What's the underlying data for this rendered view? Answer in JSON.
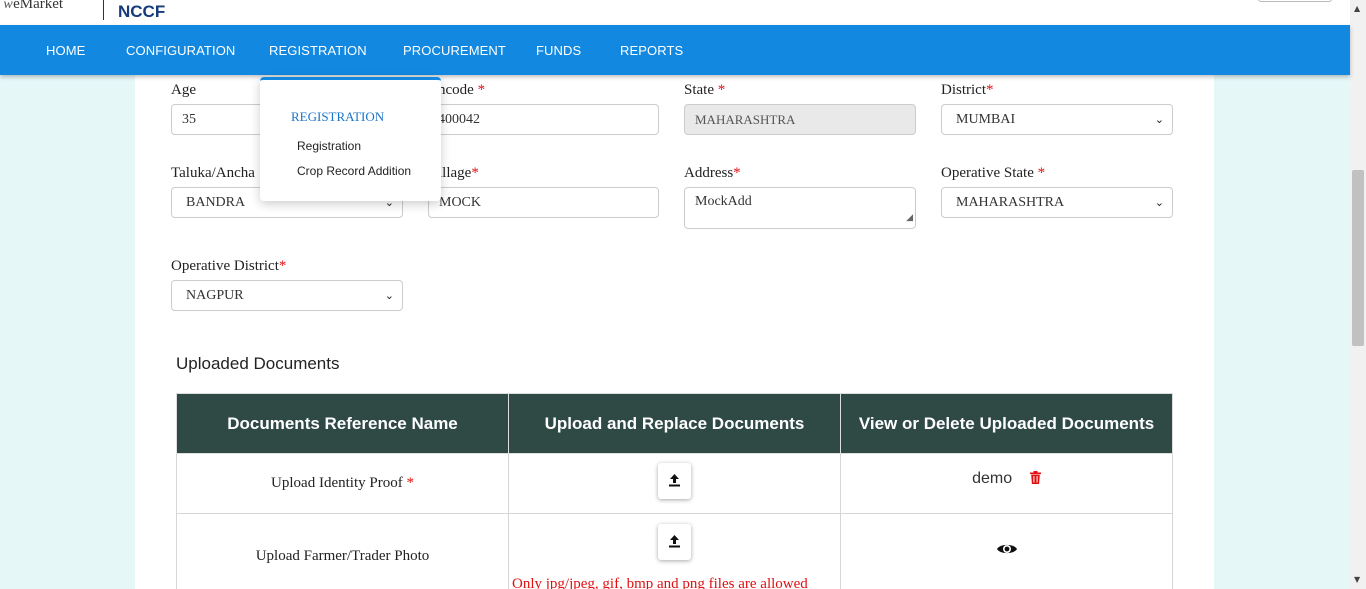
{
  "brand": {
    "emarket": "eMarket",
    "nccf": "NCCF"
  },
  "nav": [
    "HOME",
    "CONFIGURATION",
    "REGISTRATION",
    "PROCUREMENT",
    "FUNDS",
    "REPORTS"
  ],
  "dropdown": {
    "heading": "REGISTRATION",
    "items": [
      "Registration",
      "Crop Record Addition"
    ]
  },
  "form": {
    "age": {
      "label": "Age",
      "value": "35"
    },
    "pincode": {
      "label": "ncode",
      "required": "*",
      "value": "400042"
    },
    "state": {
      "label": "State",
      "required": "*",
      "value": "MAHARASHTRA"
    },
    "district": {
      "label": "District",
      "required": "*",
      "value": "MUMBAI"
    },
    "taluka": {
      "label": "Taluka/Ancha",
      "value": "BANDRA"
    },
    "village": {
      "label": "illage",
      "required": "*",
      "value": "MOCK"
    },
    "address": {
      "label": "Address",
      "required": "*",
      "value": "MockAdd"
    },
    "operative_state": {
      "label": "Operative State",
      "required": "*",
      "value": "MAHARASHTRA"
    },
    "operative_district": {
      "label": "Operative District",
      "required": "*",
      "value": "NAGPUR"
    }
  },
  "documents": {
    "title": "Uploaded Documents",
    "headers": [
      "Documents Reference Name",
      "Upload and Replace Documents",
      "View or Delete Uploaded Documents"
    ],
    "rows": [
      {
        "name": "Upload Identity Proof",
        "required": "*",
        "uploaded": "demo"
      },
      {
        "name": "Upload Farmer/Trader Photo",
        "warning": "Only jpg/jpeg, gif, bmp and png files are allowed"
      }
    ]
  },
  "colors": {
    "navbar": "#1288e0",
    "table_header": "#2f4a45",
    "required": "#e01010",
    "background": "#e6f7f8"
  }
}
